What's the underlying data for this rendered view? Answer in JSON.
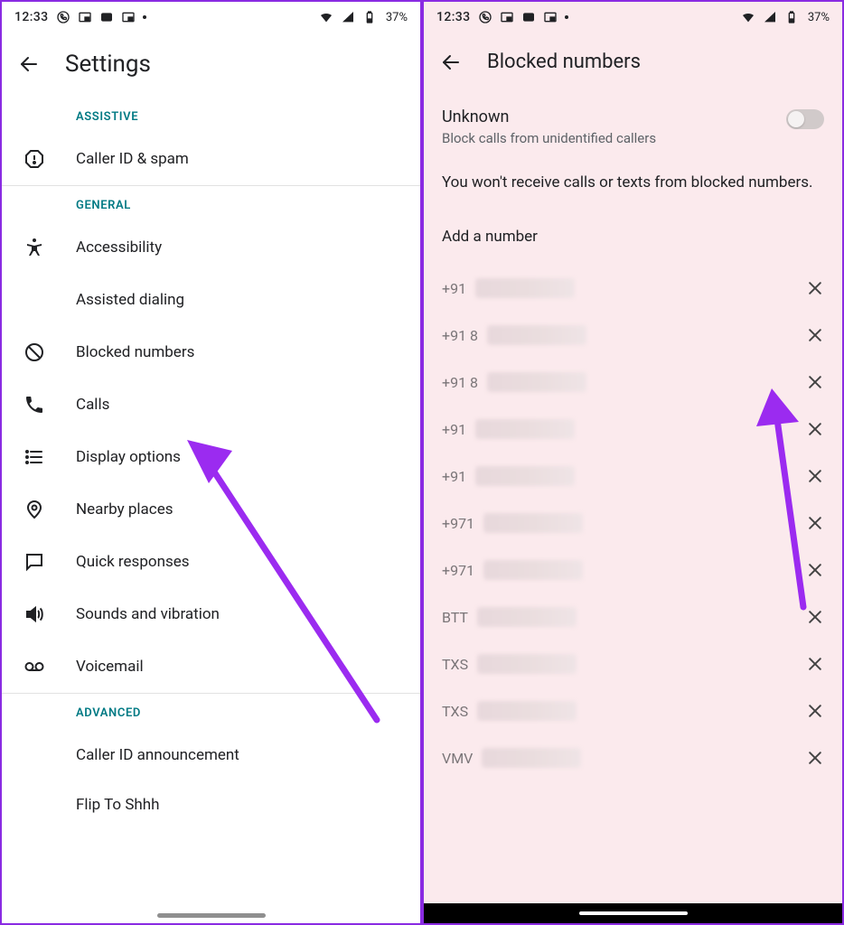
{
  "status": {
    "time": "12:33",
    "battery": "37%"
  },
  "left": {
    "title": "Settings",
    "sections": {
      "assistive": "ASSISTIVE",
      "general": "GENERAL",
      "advanced": "ADVANCED"
    },
    "items": {
      "caller_id_spam": "Caller ID & spam",
      "accessibility": "Accessibility",
      "assisted_dialing": "Assisted dialing",
      "blocked_numbers": "Blocked numbers",
      "calls": "Calls",
      "display_options": "Display options",
      "nearby_places": "Nearby places",
      "quick_responses": "Quick responses",
      "sounds_vibration": "Sounds and vibration",
      "voicemail": "Voicemail",
      "caller_id_announcement": "Caller ID announcement",
      "flip_to_shhh": "Flip To Shhh"
    }
  },
  "right": {
    "title": "Blocked numbers",
    "unknown_title": "Unknown",
    "unknown_sub": "Block calls from unidentified callers",
    "explain": "You won't receive calls or texts from blocked numbers.",
    "add": "Add a number",
    "numbers": [
      {
        "prefix": "+91"
      },
      {
        "prefix": "+91 8"
      },
      {
        "prefix": "+91 8"
      },
      {
        "prefix": "+91"
      },
      {
        "prefix": "+91"
      },
      {
        "prefix": "+971"
      },
      {
        "prefix": "+971"
      },
      {
        "prefix": "BTT"
      },
      {
        "prefix": "TXS"
      },
      {
        "prefix": "TXS"
      },
      {
        "prefix": "VMV"
      }
    ]
  },
  "colors": {
    "accent_arrow": "#9b2bf0"
  }
}
